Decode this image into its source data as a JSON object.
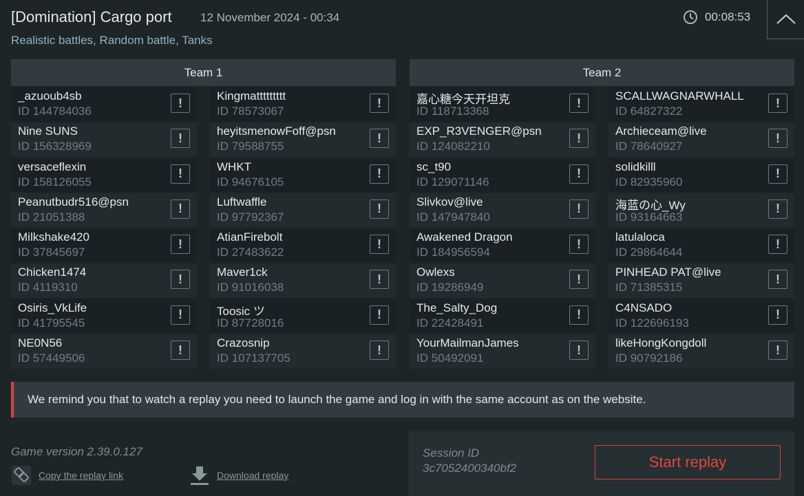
{
  "header": {
    "title": "[Domination] Cargo port",
    "date": "12 November 2024 - 00:34",
    "subtitle": "Realistic battles, Random battle, Tanks",
    "duration": "00:08:53"
  },
  "teams": [
    {
      "name": "Team 1",
      "players": [
        {
          "name": "_azuoub4sb",
          "id": "ID 144784036"
        },
        {
          "name": "Kingmattttttttt",
          "id": "ID 78573067"
        },
        {
          "name": "Nine SUNS",
          "id": "ID 156328969"
        },
        {
          "name": "heyitsmenowFoff@psn",
          "id": "ID 79588755"
        },
        {
          "name": "versaceflexin",
          "id": "ID 158126055"
        },
        {
          "name": "WHKT",
          "id": "ID 94676105"
        },
        {
          "name": "Peanutbudr516@psn",
          "id": "ID 21051388"
        },
        {
          "name": "Luftwaffle",
          "id": "ID 97792367"
        },
        {
          "name": "Milkshake420",
          "id": "ID 37845697"
        },
        {
          "name": "AtianFirebolt",
          "id": "ID 27483622"
        },
        {
          "name": "Chicken1474",
          "id": "ID 4119310"
        },
        {
          "name": "Maver1ck",
          "id": "ID 91016038"
        },
        {
          "name": "Osiris_VkLife",
          "id": "ID 41795545"
        },
        {
          "name": "Toosic ツ",
          "id": "ID 87728016"
        },
        {
          "name": "NE0N56",
          "id": "ID 57449506"
        },
        {
          "name": "Crazosnip",
          "id": "ID 107137705"
        }
      ]
    },
    {
      "name": "Team 2",
      "players": [
        {
          "name": "嘉心糖今天开坦克",
          "id": "ID 118713368"
        },
        {
          "name": "SCALLWAGNARWHALL",
          "id": "ID 64827322"
        },
        {
          "name": "EXP_R3VENGER@psn",
          "id": "ID 124082210"
        },
        {
          "name": "Archieceam@live",
          "id": "ID 78640927"
        },
        {
          "name": "sc_t90",
          "id": "ID 129071146"
        },
        {
          "name": "solidkilll",
          "id": "ID 82935960"
        },
        {
          "name": "Slivkov@live",
          "id": "ID 147947840"
        },
        {
          "name": "海蓝の心_Wy",
          "id": "ID 93164663"
        },
        {
          "name": "Awakened Dragon",
          "id": "ID 184956594"
        },
        {
          "name": "latulaloca",
          "id": "ID 29864644"
        },
        {
          "name": "Owlexs",
          "id": "ID 19286949"
        },
        {
          "name": "PINHEAD PAT@live",
          "id": "ID 71385315"
        },
        {
          "name": "The_Salty_Dog",
          "id": "ID 22428491"
        },
        {
          "name": "C4NSADO",
          "id": "ID 122696193"
        },
        {
          "name": "YourMailmanJames",
          "id": "ID 50492091"
        },
        {
          "name": "likeHongKongdoll",
          "id": "ID 90792186"
        }
      ]
    }
  ],
  "report_label": "!",
  "notice": "We remind you that to watch a replay you need to launch the game and log in with the same account as on the website.",
  "footer": {
    "game_version": "Game version 2.39.0.127",
    "copy_link_label": "Copy the replay link",
    "download_label": "Download replay",
    "session_label": "Session ID",
    "session_id": "3c7052400340bf2",
    "start_button": "Start replay"
  },
  "icons": {
    "clock": "clock-icon",
    "collapse": "chevron-up-icon",
    "copy": "link-icon",
    "download": "download-icon"
  },
  "colors": {
    "accent": "#d9413c",
    "background": "#1d2527",
    "header_bar": "#323c40"
  }
}
